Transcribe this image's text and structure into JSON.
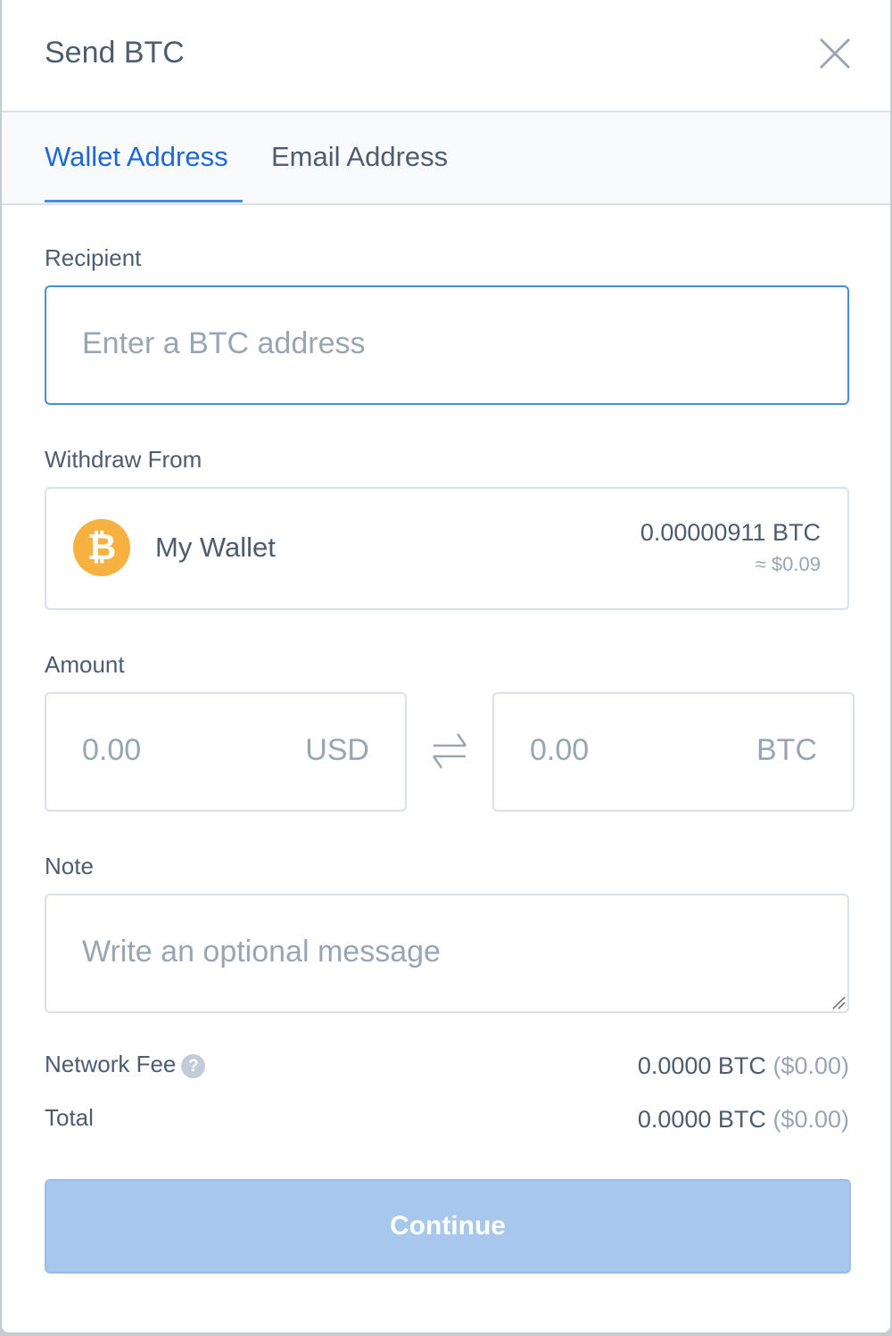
{
  "header": {
    "title": "Send BTC",
    "close_icon": "close-icon"
  },
  "tabs": [
    {
      "label": "Wallet Address",
      "active": true
    },
    {
      "label": "Email Address",
      "active": false
    }
  ],
  "recipient": {
    "label": "Recipient",
    "placeholder": "Enter a BTC address",
    "value": ""
  },
  "withdraw": {
    "label": "Withdraw From",
    "icon": "bitcoin-icon",
    "icon_glyph": "B",
    "wallet_name": "My Wallet",
    "balance_btc": "0.00000911 BTC",
    "balance_usd": "≈ $0.09"
  },
  "amount": {
    "label": "Amount",
    "usd": {
      "value": "0.00",
      "currency": "USD"
    },
    "btc": {
      "value": "0.00",
      "currency": "BTC"
    },
    "swap_icon": "swap-arrows-icon"
  },
  "note": {
    "label": "Note",
    "placeholder": "Write an optional message"
  },
  "summary": {
    "network_fee": {
      "label": "Network Fee",
      "help": "?",
      "btc": "0.0000 BTC",
      "usd": "($0.00)"
    },
    "total": {
      "label": "Total",
      "btc": "0.0000 BTC",
      "usd": "($0.00)"
    }
  },
  "actions": {
    "continue_label": "Continue"
  },
  "colors": {
    "accent": "#1d68d4",
    "button_disabled": "#a7c7ec",
    "bitcoin": "#f6b140"
  }
}
